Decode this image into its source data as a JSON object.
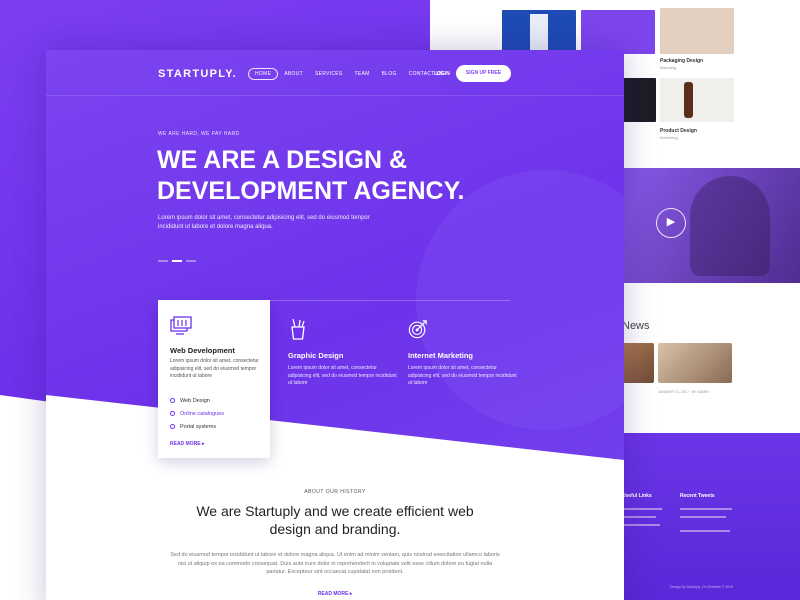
{
  "colors": {
    "accent": "#6d32ea",
    "accent_light": "#7c44f0",
    "white": "#ffffff"
  },
  "back": {
    "thumb_caption_1": "Packaging Design",
    "thumb_sub_1": "Branding",
    "thumb_caption_2": "Product Design",
    "thumb_sub_2": "Marketing",
    "news_title": "News",
    "news_meta": "JANUARY 01, 2017 · BY ADMIN",
    "footer_links_title": "Useful Links",
    "footer_tweets_title": "Recent Tweets",
    "footer_copy": "Design by Startuply, On Dribbble © 2019"
  },
  "nav": {
    "logo": "STARTUPLY.",
    "items": [
      "HOME",
      "ABOUT",
      "SERVICES",
      "TEAM",
      "BLOG",
      "CONTACT US"
    ],
    "login": "LOGIN",
    "signup": "SIGN UP FREE"
  },
  "hero": {
    "eyebrow": "WE ARE HARD, WE PAY HARD",
    "title": "WE ARE A DESIGN & DEVELOPMENT AGENCY.",
    "description": "Lorem ipsum dolor sit amet, consectetur adipisicing elit, sed do eiusmod tempor incididunt ut labore et dolore magna aliqua.",
    "slider_active_index": 1
  },
  "services": {
    "card": {
      "icon": "monitor-stack-icon",
      "title": "Web Development",
      "description": "Lorem ipsum dolor sit amet, consectetur adipisicing elit, sed do eiusmod tempor incididunt ut labore",
      "list": [
        "Web Design",
        "Online catalogues",
        "Portal systems"
      ],
      "highlighted_item": "Online catalogues",
      "link": "READ MORE ▸"
    },
    "graphic": {
      "icon": "pen-cup-icon",
      "title": "Graphic Design",
      "description": "Lorem ipsum dolor sit amet, consectetur adipisicing elit, sed do eiusmod tempor incididunt ut labore"
    },
    "marketing": {
      "icon": "target-icon",
      "title": "Internet Marketing",
      "description": "Lorem ipsum dolor sit amet, consectetur adipisicing elit, sed do eiusmod tempor incididunt ut labore"
    }
  },
  "history": {
    "eyebrow": "ABOUT OUR HISTORY",
    "title": "We are Startuply and we create efficient web design and branding.",
    "description": "Sed do eiusmod tempor incididunt ut labore et dolore magna aliqua. Ut enim ad minim veniam, quis nostrud exercitation ullamco laboris nisi ut aliquip ex ea commodo consequat. Duis aute irure dolor in reprehenderit in voluptate velit esse cillum dolore eu fugiat nulla pariatur. Excepteur sint occaecat cupidatat non proident.",
    "link": "READ MORE ▸"
  }
}
